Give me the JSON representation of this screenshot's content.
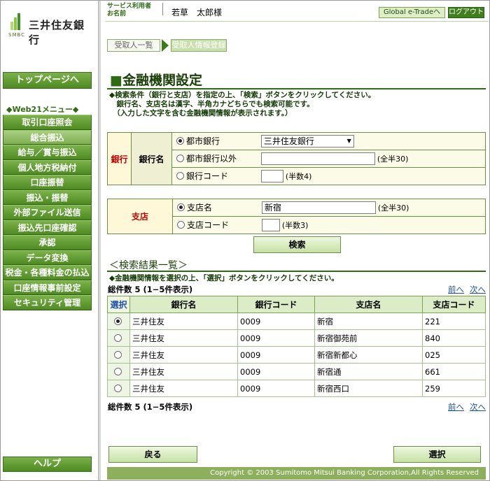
{
  "brand": {
    "name": "三井住友銀行",
    "sub": "SMBC"
  },
  "header": {
    "service_label_1": "サービス利用者",
    "service_label_2": "お名前",
    "user_name": "若草　太郎様",
    "global_button": "Global e-Tradeへ",
    "logout_button": "ログアウト"
  },
  "sidebar": {
    "top_page": "トップページへ",
    "menu_title": "◆Web21メニュー◆",
    "items": [
      {
        "label": "取引口座照会"
      },
      {
        "label": "総合振込"
      },
      {
        "label": "給与／賞与振込"
      },
      {
        "label": "個人地方税納付"
      },
      {
        "label": "口座振替"
      },
      {
        "label": "振込・振替"
      },
      {
        "label": "外部ファイル送信"
      },
      {
        "label": "振込先口座確認"
      },
      {
        "label": "承認"
      },
      {
        "label": "データ変換"
      },
      {
        "label": "税金・各種料金の払込"
      },
      {
        "label": "口座情報事前設定"
      },
      {
        "label": "セキュリティ管理"
      }
    ],
    "help": "ヘルプ"
  },
  "steps": {
    "step1": "受取人一覧",
    "step2": "受取人情報登録"
  },
  "page": {
    "title": "金融機関設定",
    "title_mark": "■",
    "instruction_1": "◆検索条件（銀行と支店）を指定の上、「検索」ボタンをクリックしてください。",
    "instruction_2": "　銀行名、支店名は漢字、半角カナどちらでも検索可能です。",
    "instruction_3": "　（入力した文字を含む金融機関情報が表示されます。）"
  },
  "bank_form": {
    "section": "銀行",
    "sub": "銀行名",
    "opt_city": "都市銀行",
    "city_value": "三井住友銀行",
    "opt_other": "都市銀行以外",
    "other_note": "(全半30)",
    "opt_code": "銀行コード",
    "code_note": "(半数4)"
  },
  "branch_form": {
    "section": "支店",
    "opt_name": "支店名",
    "name_value": "新宿",
    "name_note": "(全半30)",
    "opt_code": "支店コード",
    "code_note": "(半数3)"
  },
  "search_button": "検索",
  "results": {
    "title": "＜検索結果一覧＞",
    "instruction": "◆金融機関情報を選択の上、「選択」ボタンをクリックしてください。",
    "count_text": "総件数 5 (1−5件表示)",
    "prev": "前へ",
    "next": "次へ",
    "columns": [
      "選択",
      "銀行名",
      "銀行コード",
      "支店名",
      "支店コード"
    ],
    "rows": [
      {
        "bank": "三井住友",
        "bank_code": "0009",
        "branch": "新宿",
        "branch_code": "221",
        "selected": true
      },
      {
        "bank": "三井住友",
        "bank_code": "0009",
        "branch": "新宿御苑前",
        "branch_code": "840",
        "selected": false
      },
      {
        "bank": "三井住友",
        "bank_code": "0009",
        "branch": "新宿新都心",
        "branch_code": "025",
        "selected": false
      },
      {
        "bank": "三井住友",
        "bank_code": "0009",
        "branch": "新宿通",
        "branch_code": "661",
        "selected": false
      },
      {
        "bank": "三井住友",
        "bank_code": "0009",
        "branch": "新宿西口",
        "branch_code": "259",
        "selected": false
      }
    ]
  },
  "buttons": {
    "back": "戻る",
    "select": "選択"
  },
  "footer": "Copyright © 2003 Sumitomo Mitsui Banking Corporation,All Rights Reserved"
}
